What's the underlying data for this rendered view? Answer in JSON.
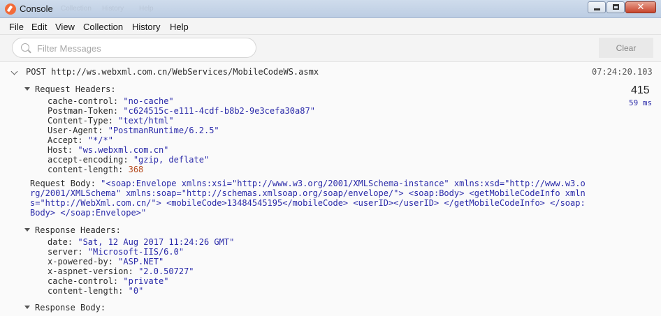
{
  "window": {
    "title": "Console",
    "ghost_menu": [
      "Collection",
      "History",
      "Help"
    ]
  },
  "menu": [
    "File",
    "Edit",
    "View",
    "Collection",
    "History",
    "Help"
  ],
  "filter": {
    "placeholder": "Filter Messages",
    "clear_label": "Clear"
  },
  "request": {
    "method": "POST",
    "url": "http://ws.webxml.com.cn/WebServices/MobileCodeWS.asmx",
    "timestamp": "07:24:20.103",
    "status": "415",
    "duration": "59 ms",
    "headers_label": "Request Headers:",
    "headers": [
      {
        "key": "cache-control:",
        "value": "\"no-cache\""
      },
      {
        "key": "Postman-Token:",
        "value": "\"c624515c-e111-4cdf-b8b2-9e3cefa30a87\""
      },
      {
        "key": "Content-Type:",
        "value": "\"text/html\""
      },
      {
        "key": "User-Agent:",
        "value": "\"PostmanRuntime/6.2.5\""
      },
      {
        "key": "Accept:",
        "value": "\"*/*\""
      },
      {
        "key": "Host:",
        "value": "\"ws.webxml.com.cn\""
      },
      {
        "key": "accept-encoding:",
        "value": "\"gzip, deflate\""
      },
      {
        "key": "content-length:",
        "value": "368"
      }
    ],
    "body_label": "Request Body:",
    "body": "\"<soap:Envelope xmlns:xsi=\"http://www.w3.org/2001/XMLSchema-instance\" xmlns:xsd=\"http://www.w3.org/2001/XMLSchema\" xmlns:soap=\"http://schemas.xmlsoap.org/soap/envelope/\"> <soap:Body> <getMobileCodeInfo xmlns=\"http://WebXml.com.cn/\"> <mobileCode>13484545195</mobileCode> <userID></userID> </getMobileCodeInfo> </soap:Body> </soap:Envelope>\""
  },
  "response": {
    "headers_label": "Response Headers:",
    "headers": [
      {
        "key": "date:",
        "value": "\"Sat, 12 Aug 2017 11:24:26 GMT\""
      },
      {
        "key": "server:",
        "value": "\"Microsoft-IIS/6.0\""
      },
      {
        "key": "x-powered-by:",
        "value": "\"ASP.NET\""
      },
      {
        "key": "x-aspnet-version:",
        "value": "\"2.0.50727\""
      },
      {
        "key": "cache-control:",
        "value": "\"private\""
      },
      {
        "key": "content-length:",
        "value": "\"0\""
      }
    ],
    "body_label": "Response Body:"
  },
  "colors": {
    "titlebar": "#c6d6ea",
    "value_text": "#2a2aa9",
    "number_text": "#b54a1d",
    "logo": "#f26b3a"
  }
}
